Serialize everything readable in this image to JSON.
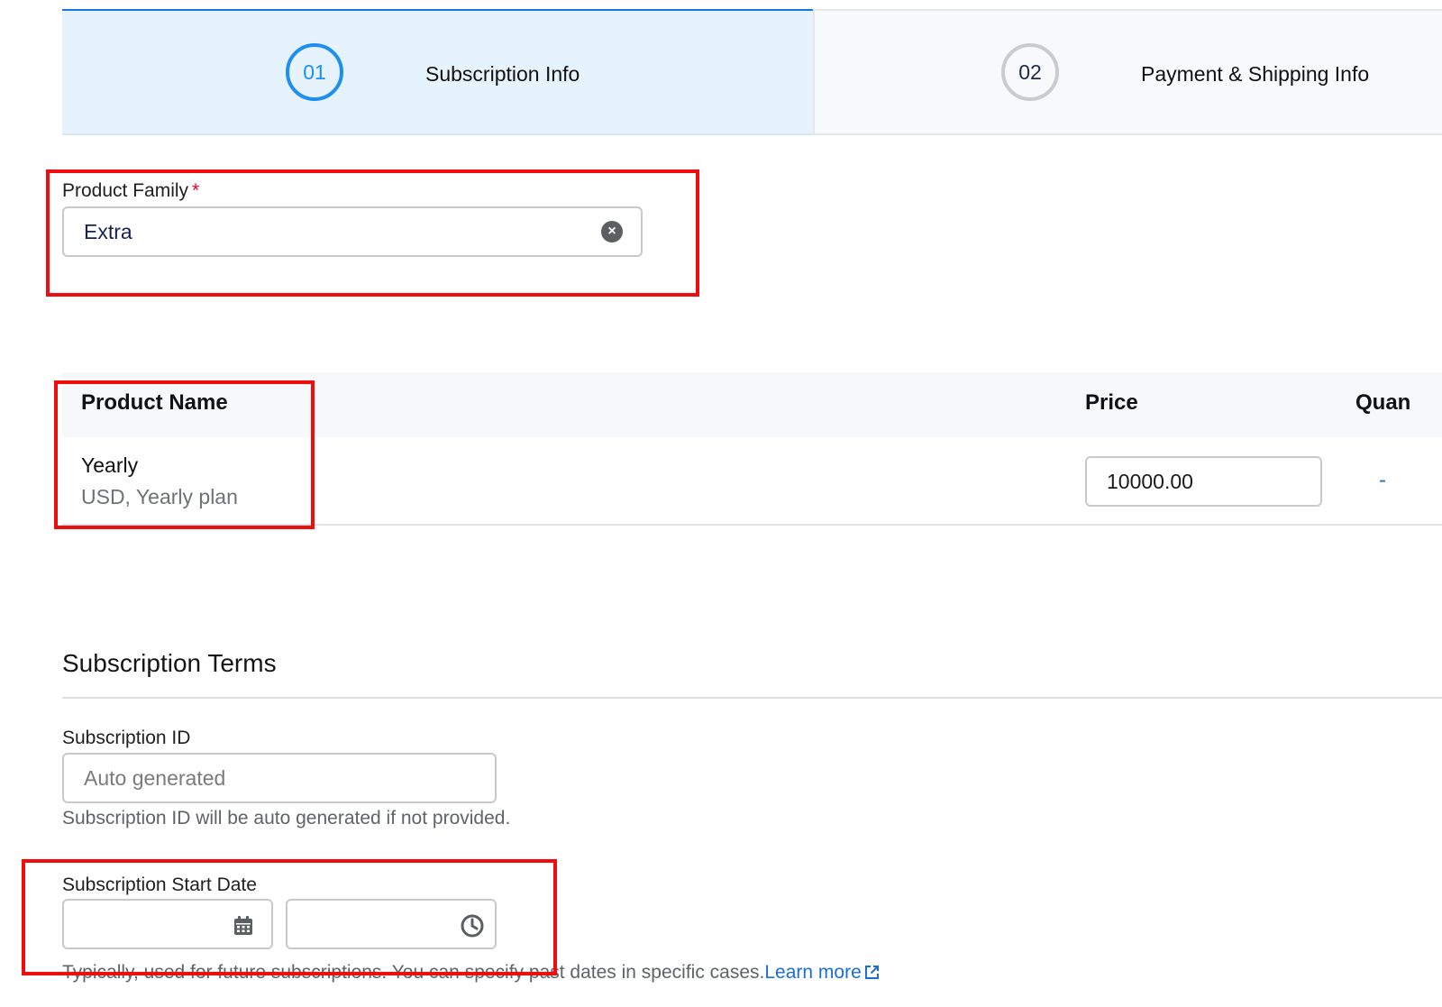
{
  "stepper": {
    "steps": [
      {
        "number": "01",
        "label": "Subscription Info"
      },
      {
        "number": "02",
        "label": "Payment & Shipping Info"
      }
    ]
  },
  "product_family": {
    "label": "Product Family",
    "required_mark": "*",
    "value": "Extra",
    "clear_icon": "clear-circle-icon"
  },
  "table": {
    "headers": {
      "name": "Product Name",
      "price": "Price",
      "quantity": "Quan"
    },
    "rows": [
      {
        "name": "Yearly",
        "subtitle": "USD, Yearly plan",
        "price": "10000.00",
        "quantity_control": "-"
      }
    ]
  },
  "subscription_terms": {
    "title": "Subscription Terms",
    "subscription_id": {
      "label": "Subscription ID",
      "placeholder": "Auto generated",
      "help": "Subscription ID will be auto generated if not provided."
    },
    "start_date": {
      "label": "Subscription Start Date",
      "date_icon": "calendar-icon",
      "time_icon": "clock-icon",
      "help": "Typically, used for future subscriptions. You can specify past dates in specific cases.",
      "learn_more": "Learn more",
      "learn_more_icon": "external-link-icon"
    }
  },
  "colors": {
    "accent": "#1e8fef",
    "highlight": "#ef0d0d",
    "link": "#1a6fd6"
  }
}
